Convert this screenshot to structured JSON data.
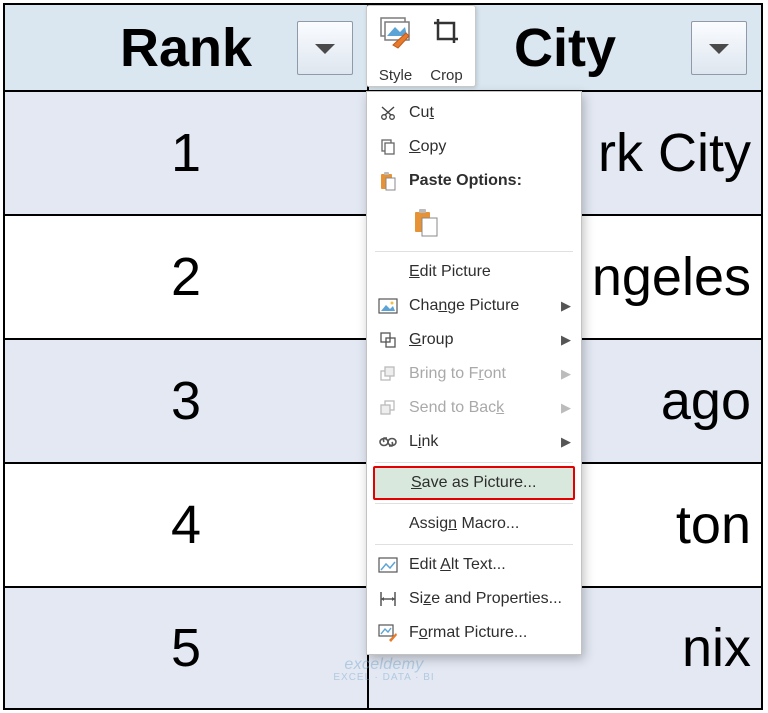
{
  "table": {
    "headers": {
      "rank": "Rank",
      "city": "City"
    },
    "rows": [
      {
        "rank": "1",
        "city": "rk City"
      },
      {
        "rank": "2",
        "city": "ngeles"
      },
      {
        "rank": "3",
        "city": "ago"
      },
      {
        "rank": "4",
        "city": "ton"
      },
      {
        "rank": "5",
        "city": "nix"
      }
    ]
  },
  "mini_toolbar": {
    "style": "Style",
    "crop": "Crop"
  },
  "context_menu": {
    "cut": "Cut",
    "copy": "Copy",
    "paste_options": "Paste Options:",
    "edit_picture": "Edit Picture",
    "change_picture": "Change Picture",
    "group": "Group",
    "bring_front": "Bring to Front",
    "send_back": "Send to Back",
    "link": "Link",
    "save_as_picture": "Save as Picture...",
    "assign_macro": "Assign Macro...",
    "edit_alt_text": "Edit Alt Text...",
    "size_properties": "Size and Properties...",
    "format_picture": "Format Picture..."
  },
  "watermark": {
    "main": "exceldemy",
    "sub": "EXCEL · DATA · BI"
  }
}
